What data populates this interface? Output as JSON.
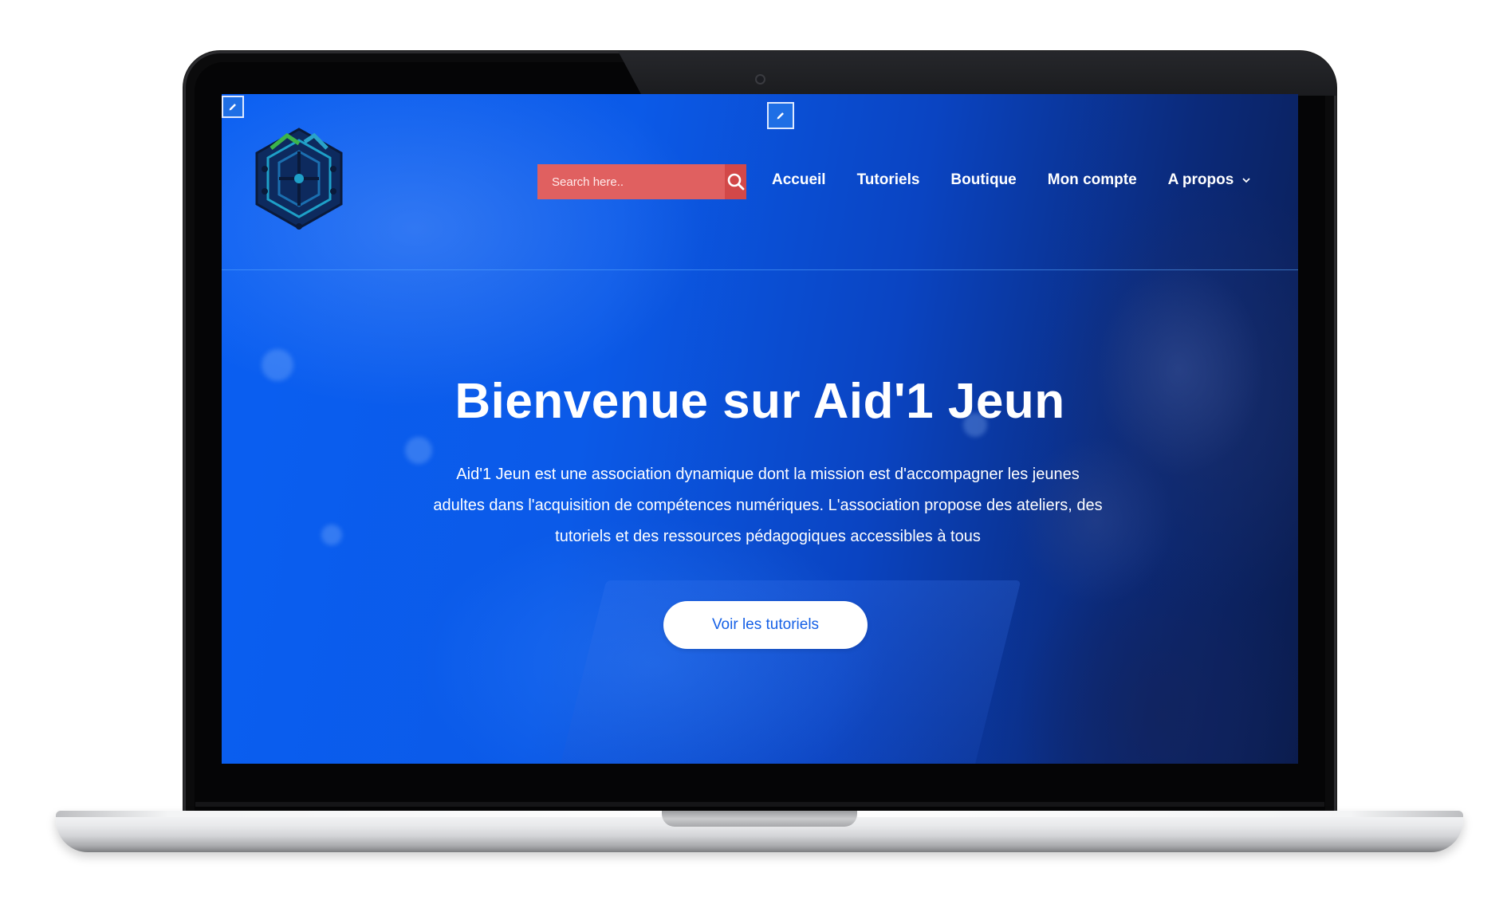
{
  "search": {
    "placeholder": "Search here.."
  },
  "nav": {
    "items": [
      {
        "label": "Accueil"
      },
      {
        "label": "Tutoriels"
      },
      {
        "label": "Boutique"
      },
      {
        "label": "Mon compte"
      },
      {
        "label": "A propos",
        "has_dropdown": true
      }
    ]
  },
  "hero": {
    "title": "Bienvenue sur Aid'1 Jeun",
    "text": "Aid'1 Jeun est une association dynamique dont la mission est d'accompagner les jeunes adultes dans l'acquisition de compétences numériques. L'association propose des ateliers, des tutoriels et des ressources pédagogiques accessibles à tous",
    "cta_label": "Voir les tutoriels"
  },
  "colors": {
    "hero_blue": "#0a5ff2",
    "search_bg": "#e06060",
    "search_button": "#d24848",
    "cta_text": "#1560e6"
  },
  "icons": {
    "search": "search-icon",
    "dropdown": "chevron-down-icon",
    "edit": "pencil-icon",
    "logo": "circuit-hexagon-logo"
  }
}
